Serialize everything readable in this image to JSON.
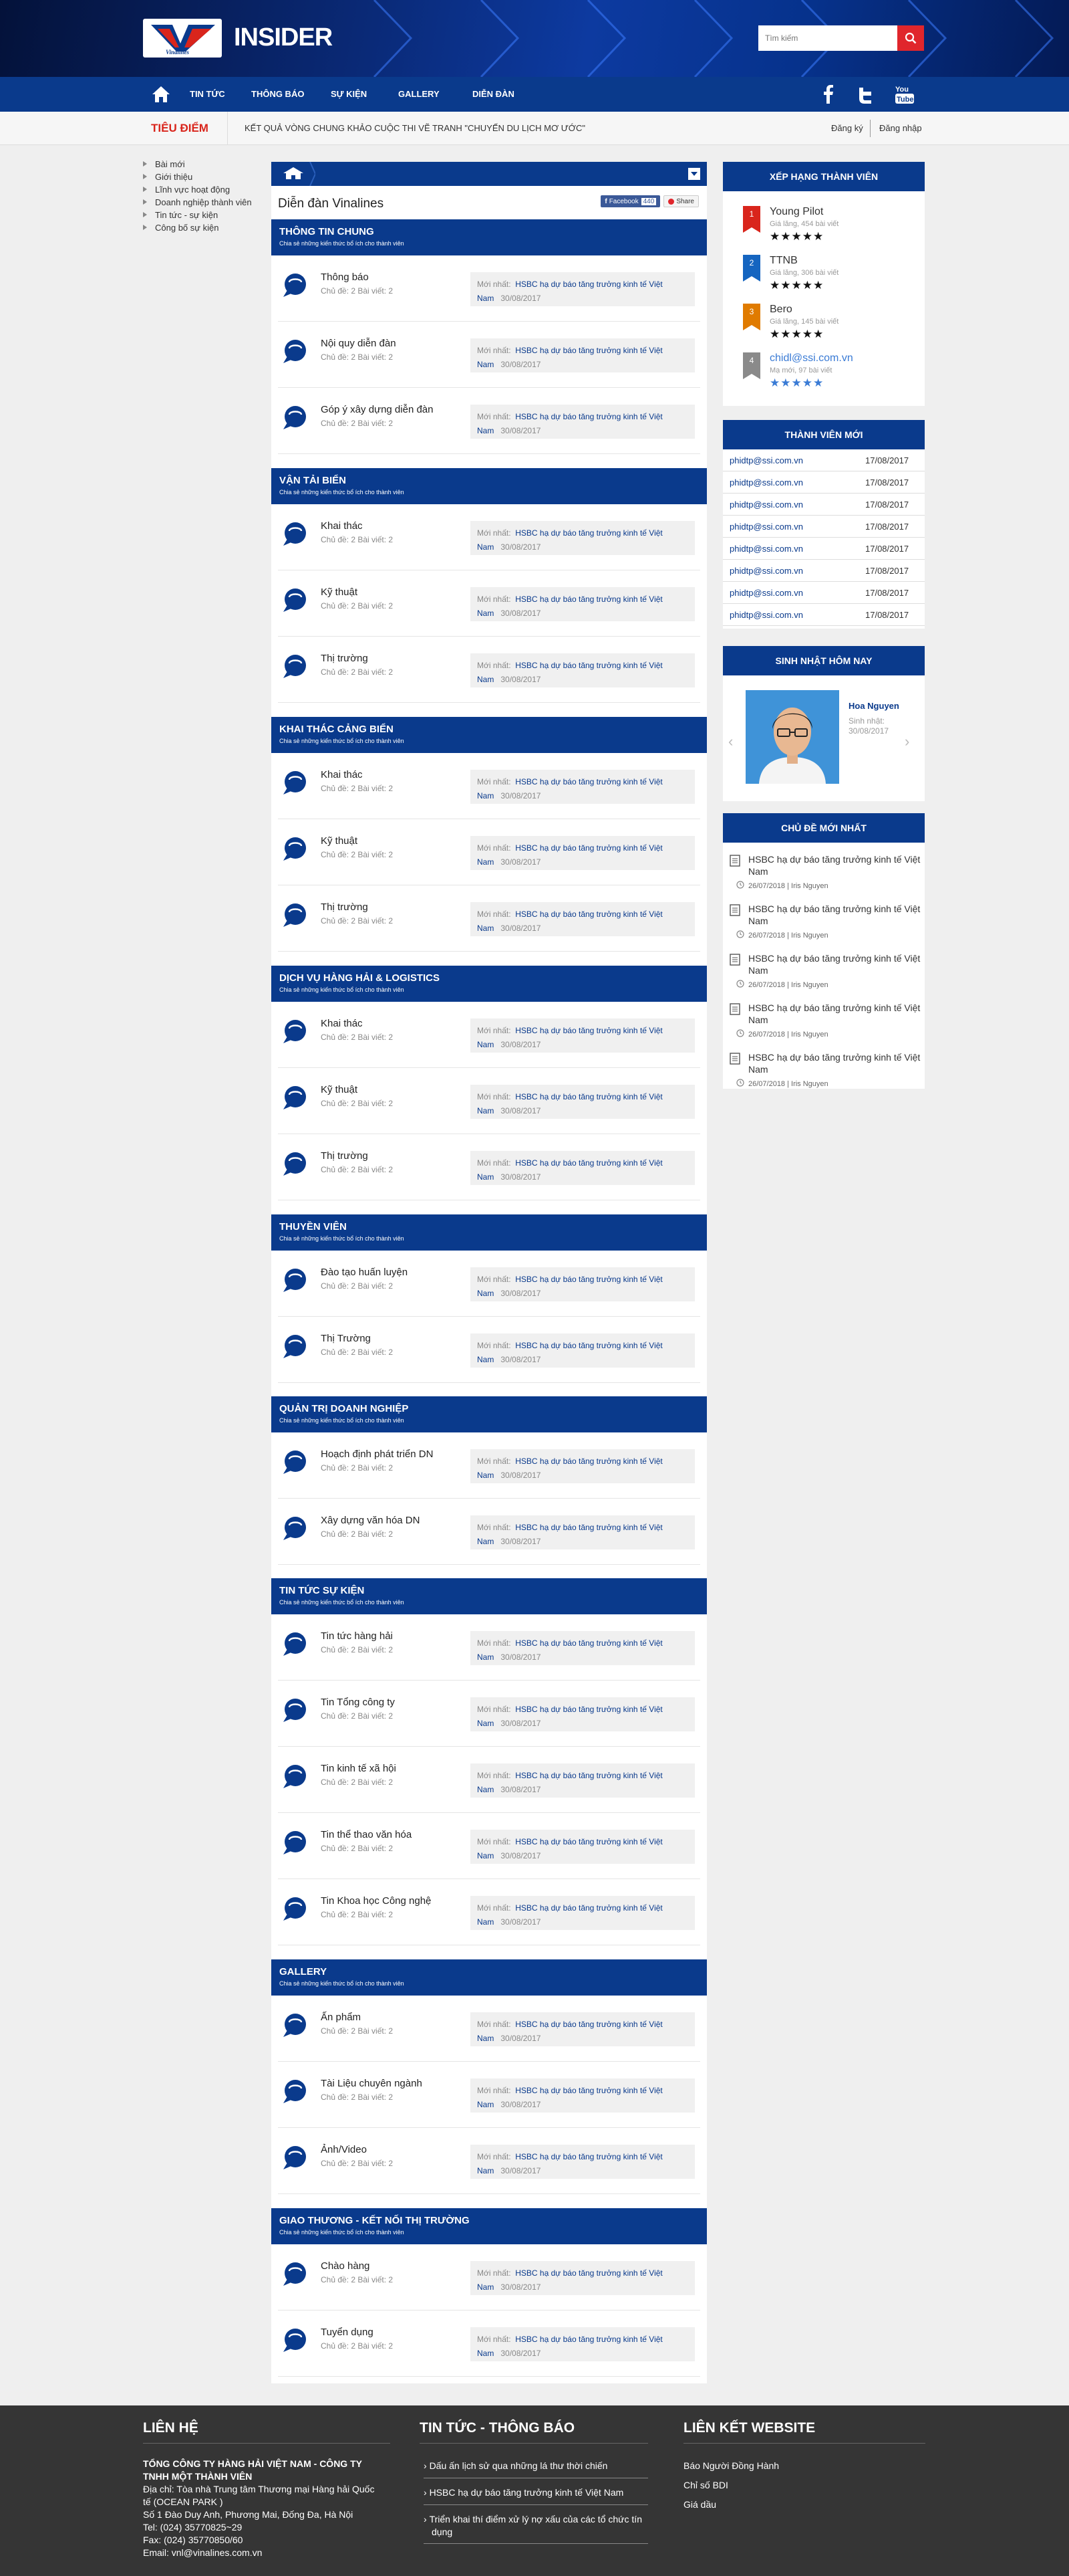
{
  "brand": {
    "logo_text": "Vinalines",
    "site_name": "INSIDER"
  },
  "search": {
    "placeholder": "Tìm kiếm"
  },
  "nav": {
    "items": [
      "TIN TỨC",
      "THÔNG BÁO",
      "SỰ KIỆN",
      "GALLERY",
      "DIỄN ĐÀN"
    ]
  },
  "ticker": {
    "label": "TIÊU ĐIỂM",
    "text": "KẾT QUẢ VÒNG CHUNG KHẢO CUỘC THI VẼ TRANH \"CHUYẾN DU LỊCH MƠ ƯỚC\"",
    "register": "Đăng ký",
    "login": "Đăng nhập"
  },
  "leftnav": [
    "Bài mới",
    "Giới thiệu",
    "Lĩnh vực hoạt động",
    "Doanh nghiệp thành viên",
    "Tin tức - sự kiện",
    "Công bố sự kiện"
  ],
  "forum": {
    "title": "Diễn đàn Vinalines",
    "facebook_label": "Facebook",
    "facebook_count": "440",
    "share_label": "Share",
    "latest_prefix": "Mới nhất:",
    "latest_link": "HSBC hạ dự báo tăng trưởng kinh tế Việt",
    "latest_link_2": "Nam",
    "latest_date": "30/08/2017",
    "counts": "Chủ đề: 2   Bài viết: 2",
    "sections": [
      {
        "title": "THÔNG TIN CHUNG",
        "subtitle": "Chia sẻ những kiến thức bổ ích cho thành viên",
        "rows": [
          "Thông báo",
          "Nội quy diễn đàn",
          "Góp ý xây dựng diễn đàn"
        ]
      },
      {
        "title": "VẬN TẢI BIỂN",
        "subtitle": "Chia sẻ những kiến thức bổ ích cho thành viên",
        "rows": [
          "Khai thác",
          "Kỹ thuật",
          "Thị trường"
        ]
      },
      {
        "title": "KHAI THÁC CẢNG BIỂN",
        "subtitle": "Chia sẻ những kiến thức bổ ích cho thành viên",
        "rows": [
          "Khai thác",
          "Kỹ thuật",
          "Thị trường"
        ]
      },
      {
        "title": "DỊCH VỤ HÀNG HẢI & LOGISTICS",
        "subtitle": "Chia sẻ những kiến thức bổ ích cho thành viên",
        "rows": [
          "Khai thác",
          "Kỹ thuật",
          "Thị trường"
        ]
      },
      {
        "title": "THUYỀN VIÊN",
        "subtitle": "Chia sẻ những kiến thức bổ ích cho thành viên",
        "rows": [
          "Đào tạo huấn luyện",
          "Thị Trường"
        ]
      },
      {
        "title": "QUẢN TRỊ DOANH NGHIỆP",
        "subtitle": "Chia sẻ những kiến thức bổ ích cho thành viên",
        "rows": [
          "Hoạch định phát triển DN",
          "Xây dựng văn hóa DN"
        ]
      },
      {
        "title": "TIN TỨC SỰ KIỆN",
        "subtitle": "Chia sẻ những kiến thức bổ ích cho thành viên",
        "rows": [
          "Tin tức hàng hải",
          "Tin Tổng công ty",
          "Tin kinh tế xã hội",
          "Tin thể thao văn hóa",
          "Tin Khoa học Công nghệ"
        ]
      },
      {
        "title": "GALLERY",
        "subtitle": "Chia sẻ những kiến thức bổ ích cho thành viên",
        "rows": [
          "Ấn phẩm",
          "Tài Liệu chuyên ngành",
          "Ảnh/Video"
        ]
      },
      {
        "title": "GIAO THƯƠNG - KẾT NỐI THỊ TRƯỜNG",
        "subtitle": "Chia sẻ những kiến thức bổ ích cho thành viên",
        "rows": [
          "Chào hàng",
          "Tuyển dụng"
        ]
      }
    ]
  },
  "ranking": {
    "title": "XẾP HẠNG THÀNH VIÊN",
    "members": [
      {
        "rank": "1",
        "name": "Young Pilot",
        "meta": "Giá lăng, 454 bài viết",
        "color": "#d9251c"
      },
      {
        "rank": "2",
        "name": "TTNB",
        "meta": "Giá lăng, 306 bài viết",
        "color": "#1565c0"
      },
      {
        "rank": "3",
        "name": "Bero",
        "meta": "Giá lăng, 145 bài viết",
        "color": "#e07b00"
      },
      {
        "rank": "4",
        "name": "chidl@ssi.com.vn",
        "meta": "Mạ mới, 97 bài viết",
        "color": "#8a8a8a"
      }
    ],
    "stars": "★★★★★"
  },
  "new_members": {
    "title": "THÀNH VIÊN MỚI",
    "rows": [
      {
        "email": "phidtp@ssi.com.vn",
        "date": "17/08/2017"
      },
      {
        "email": "phidtp@ssi.com.vn",
        "date": "17/08/2017"
      },
      {
        "email": "phidtp@ssi.com.vn",
        "date": "17/08/2017"
      },
      {
        "email": "phidtp@ssi.com.vn",
        "date": "17/08/2017"
      },
      {
        "email": "phidtp@ssi.com.vn",
        "date": "17/08/2017"
      },
      {
        "email": "phidtp@ssi.com.vn",
        "date": "17/08/2017"
      },
      {
        "email": "phidtp@ssi.com.vn",
        "date": "17/08/2017"
      },
      {
        "email": "phidtp@ssi.com.vn",
        "date": "17/08/2017"
      }
    ]
  },
  "birthday": {
    "title": "SINH NHẬT HÔM NAY",
    "name": "Hoa Nguyen",
    "label": "Sinh nhật:",
    "date": "30/08/2017"
  },
  "topics": {
    "title": "CHỦ ĐỀ MỚI NHẤT",
    "meta": "26/07/2018  |  Iris Nguyen",
    "items": [
      {
        "l1": "HSBC hạ dự báo tăng trưởng kinh tế Việt",
        "l2": "Nam"
      },
      {
        "l1": "HSBC hạ dự báo tăng trưởng kinh tế Việt",
        "l2": "Nam"
      },
      {
        "l1": "HSBC hạ dự báo tăng trưởng kinh tế Việt",
        "l2": "Nam"
      },
      {
        "l1": "HSBC hạ dự báo tăng trưởng kinh tế Việt",
        "l2": "Nam"
      },
      {
        "l1": "HSBC hạ dự báo tăng trưởng kinh tế Việt",
        "l2": "Nam"
      }
    ]
  },
  "footer": {
    "contact_title": "LIÊN HỆ",
    "company_1": "TỔNG CÔNG TY HÀNG HẢI VIỆT NAM - CÔNG TY",
    "company_2": "TNHH MỘT THÀNH VIÊN",
    "address_1": "Địa chỉ: Tòa nhà Trung tâm Thương mại Hàng hải Quốc",
    "address_2": "tế (OCEAN PARK )",
    "address_3": "Số 1 Đào Duy Anh, Phương Mai, Đống Đa, Hà Nội",
    "tel": "Tel: (024) 35770825~29",
    "fax": "Fax: (024) 35770850/60",
    "email": "Email: vnl@vinalines.com.vn",
    "news_title": "TIN TỨC - THÔNG BÁO",
    "news": [
      "Dấu ấn lịch sử qua những lá thư thời chiến",
      "HSBC hạ dự báo tăng trưởng kinh tế Việt Nam",
      "Triển khai thí điểm xử lý nợ xấu của các tổ chức tín",
      "dụng"
    ],
    "links_title": "LIÊN KẾT WEBSITE",
    "links": [
      "Báo Người Đồng Hành",
      "Chỉ số BDI",
      "Giá dầu"
    ]
  },
  "colors": {
    "primary": "#0a3a8c",
    "accent": "#e0262c",
    "footer": "#353535"
  }
}
